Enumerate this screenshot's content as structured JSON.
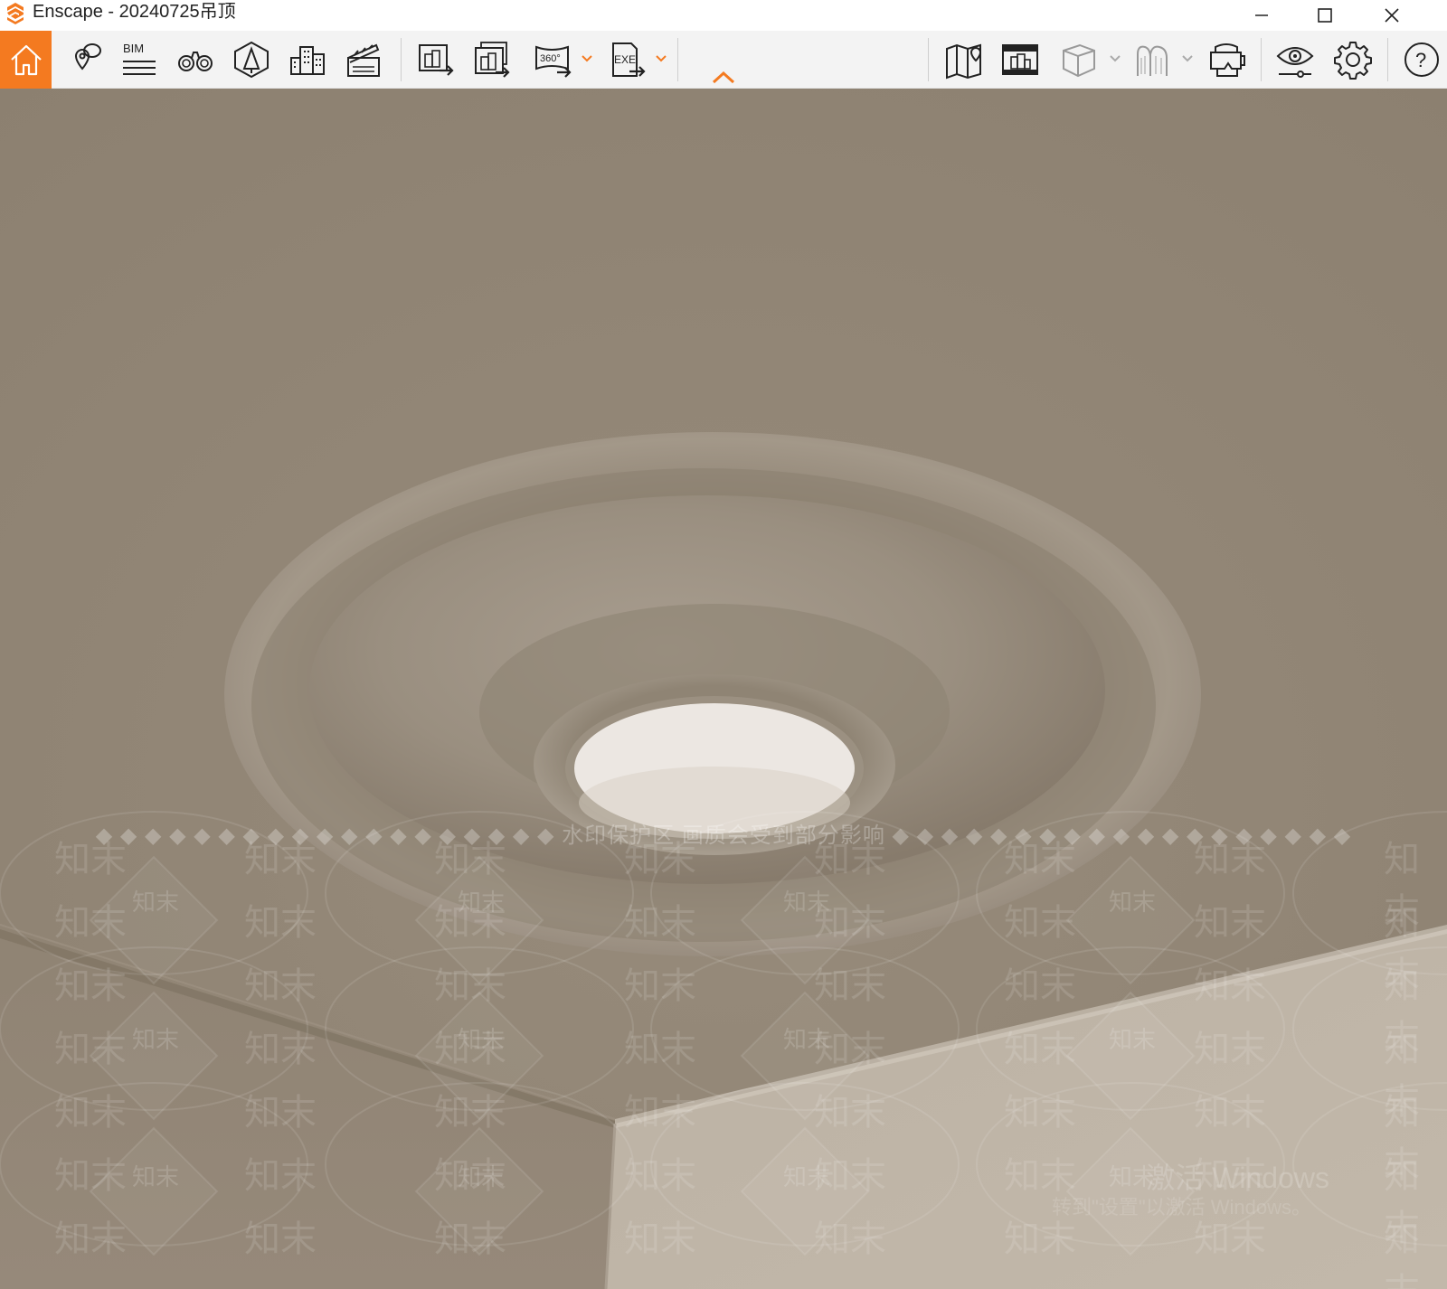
{
  "window": {
    "title": "Enscape - 20240725吊顶",
    "controls": [
      "minimize-icon",
      "maximize-icon",
      "close-icon"
    ]
  },
  "toolbar": {
    "accent": "#f47a20",
    "buttons": [
      {
        "name": "home",
        "icon": "home-icon"
      },
      {
        "name": "views",
        "icon": "map-pin-views-icon"
      },
      {
        "name": "bim",
        "icon": "bim-icon",
        "label": "BIM"
      },
      {
        "name": "walk",
        "icon": "binoculars-icon"
      },
      {
        "name": "asset-library",
        "icon": "asset-library-icon"
      },
      {
        "name": "site-context",
        "icon": "buildings-icon"
      },
      {
        "name": "video-editor",
        "icon": "clapper-icon"
      },
      {
        "name": "render-image",
        "icon": "render-image-icon"
      },
      {
        "name": "batch-render",
        "icon": "batch-render-icon"
      },
      {
        "name": "panorama",
        "icon": "panorama-360-icon",
        "label": "360°"
      },
      {
        "name": "export-exe",
        "icon": "export-exe-icon",
        "label": "EXE"
      },
      {
        "name": "map",
        "icon": "map-icon"
      },
      {
        "name": "web-standalone",
        "icon": "web-standalone-icon"
      },
      {
        "name": "cube",
        "icon": "cube-icon"
      },
      {
        "name": "vr-headset",
        "icon": "vr-headset-icon"
      },
      {
        "name": "visual-settings",
        "icon": "eye-settings-icon"
      },
      {
        "name": "general-settings",
        "icon": "gear-icon"
      },
      {
        "name": "help",
        "icon": "help-icon",
        "label": "?"
      }
    ]
  },
  "viewport": {
    "scene": "ceiling-medallion-render",
    "watermark_notice": "◆ ◆ ◆ ◆ ◆ ◆ ◆ ◆ ◆ ◆ ◆ ◆ ◆ ◆ ◆ ◆ ◆ ◆ ◆ 水印保护区 画质会受到部分影响 ◆ ◆ ◆ ◆ ◆ ◆ ◆ ◆ ◆ ◆ ◆ ◆ ◆ ◆ ◆ ◆ ◆ ◆ ◆",
    "watermark_tile": "知末",
    "activate_windows": "激活 Windows",
    "activate_hint": "转到\"设置\"以激活 Windows。"
  }
}
